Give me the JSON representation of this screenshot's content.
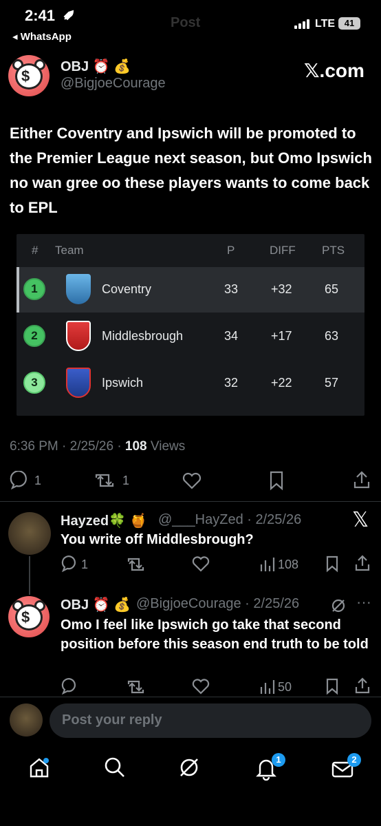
{
  "status_bar": {
    "time": "2:41",
    "back_app": "◂ WhatsApp",
    "faded_title": "Post",
    "network": "LTE",
    "battery": "41"
  },
  "post": {
    "author_name": "OBJ ⏰ 💰",
    "author_handle": "@BigjoeCourage",
    "source": "𝕏.com",
    "text": "Either Coventry and Ipswich will be promoted to the Premier League next season, but Omo Ipswich no wan gree oo these players wants to come back to EPL",
    "timestamp": "6:36 PM · 2/25/26 · ",
    "views_count": "108",
    "views_label": " Views",
    "actions": {
      "replies": "1",
      "reposts": "1"
    }
  },
  "table": {
    "headers": {
      "rank": "#",
      "team": "Team",
      "played": "P",
      "diff": "DIFF",
      "points": "PTS"
    },
    "rows": [
      {
        "rank": "1",
        "team": "Coventry",
        "played": "33",
        "diff": "+32",
        "points": "65"
      },
      {
        "rank": "2",
        "team": "Middlesbrough",
        "played": "34",
        "diff": "+17",
        "points": "63"
      },
      {
        "rank": "3",
        "team": "Ipswich",
        "played": "32",
        "diff": "+22",
        "points": "57"
      }
    ]
  },
  "replies": [
    {
      "name": "Hayzed🍀 🍯",
      "meta": "@___HayZed · 2/25/26",
      "text": "You write off Middlesbrough?",
      "reply_count": "1",
      "views": "108"
    },
    {
      "name": "OBJ ⏰ 💰",
      "meta": "@BigjoeCourage · 2/25/26",
      "text": "Omo I feel like Ipswich go take that second position before this season end truth to be told",
      "views": "50"
    }
  ],
  "composer": {
    "placeholder": "Post your reply"
  },
  "tab_bar": {
    "notifications_badge": "1",
    "messages_badge": "2"
  },
  "colors": {
    "background": "#000000",
    "accent": "#1d9bf0",
    "rank_green": "#45c262"
  }
}
